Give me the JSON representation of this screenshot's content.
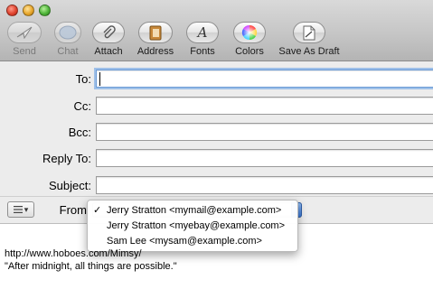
{
  "window": {
    "traffic_lights": [
      "close",
      "minimize",
      "zoom"
    ]
  },
  "toolbar": {
    "items": [
      {
        "label": "Send",
        "icon": "send-icon",
        "enabled": false
      },
      {
        "label": "Chat",
        "icon": "chat-icon",
        "enabled": false
      },
      {
        "label": "Attach",
        "icon": "paperclip-icon",
        "enabled": true
      },
      {
        "label": "Address",
        "icon": "address-book-icon",
        "enabled": true
      },
      {
        "label": "Fonts",
        "icon": "fonts-icon",
        "enabled": true
      },
      {
        "label": "Colors",
        "icon": "color-wheel-icon",
        "enabled": true
      },
      {
        "label": "Save As Draft",
        "icon": "draft-icon",
        "enabled": true
      }
    ]
  },
  "fields": {
    "to": {
      "label": "To:",
      "value": ""
    },
    "cc": {
      "label": "Cc:",
      "value": ""
    },
    "bcc": {
      "label": "Bcc:",
      "value": ""
    },
    "reply_to": {
      "label": "Reply To:",
      "value": ""
    },
    "subject": {
      "label": "Subject:",
      "value": ""
    },
    "from": {
      "label": "From"
    }
  },
  "from_menu": {
    "options": [
      {
        "label": "Jerry Stratton <mymail@example.com>",
        "checked": true
      },
      {
        "label": "Jerry Stratton <myebay@example.com>",
        "checked": false
      },
      {
        "label": "Sam Lee <mysam@example.com>",
        "checked": false
      }
    ],
    "check_mark": "✓"
  },
  "body": {
    "signature_lines": [
      "http://www.hoboes.com/Mimsy/",
      "\"After midnight, all things are possible.\""
    ]
  },
  "colors": {
    "focus_ring": "#9fc0e8",
    "popup_arrow": "#3a77d6"
  }
}
